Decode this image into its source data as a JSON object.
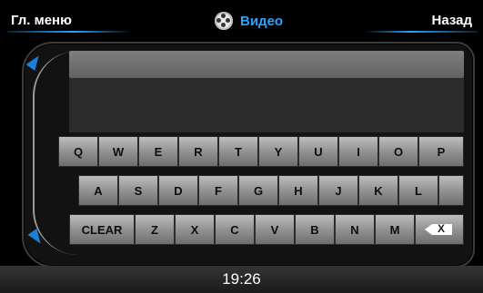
{
  "topbar": {
    "left_button": "Гл. меню",
    "title": "Видео",
    "right_button": "Назад"
  },
  "keyboard": {
    "row1": [
      "Q",
      "W",
      "E",
      "R",
      "T",
      "Y",
      "U",
      "I",
      "O",
      "P"
    ],
    "row2": [
      "A",
      "S",
      "D",
      "F",
      "G",
      "H",
      "J",
      "K",
      "L"
    ],
    "row3": [
      "CLEAR",
      "Z",
      "X",
      "C",
      "V",
      "B",
      "N",
      "M"
    ],
    "backspace_label": "X"
  },
  "input": {
    "value": ""
  },
  "status": {
    "time": "19:26"
  },
  "colors": {
    "accent": "#2aa4ff",
    "arrows": "#1e7fd6"
  },
  "icons": {
    "title_icon": "film-reel-icon",
    "up_arrow": "scroll-up-arrow-icon",
    "down_arrow": "scroll-down-arrow-icon",
    "backspace": "backspace-icon"
  }
}
